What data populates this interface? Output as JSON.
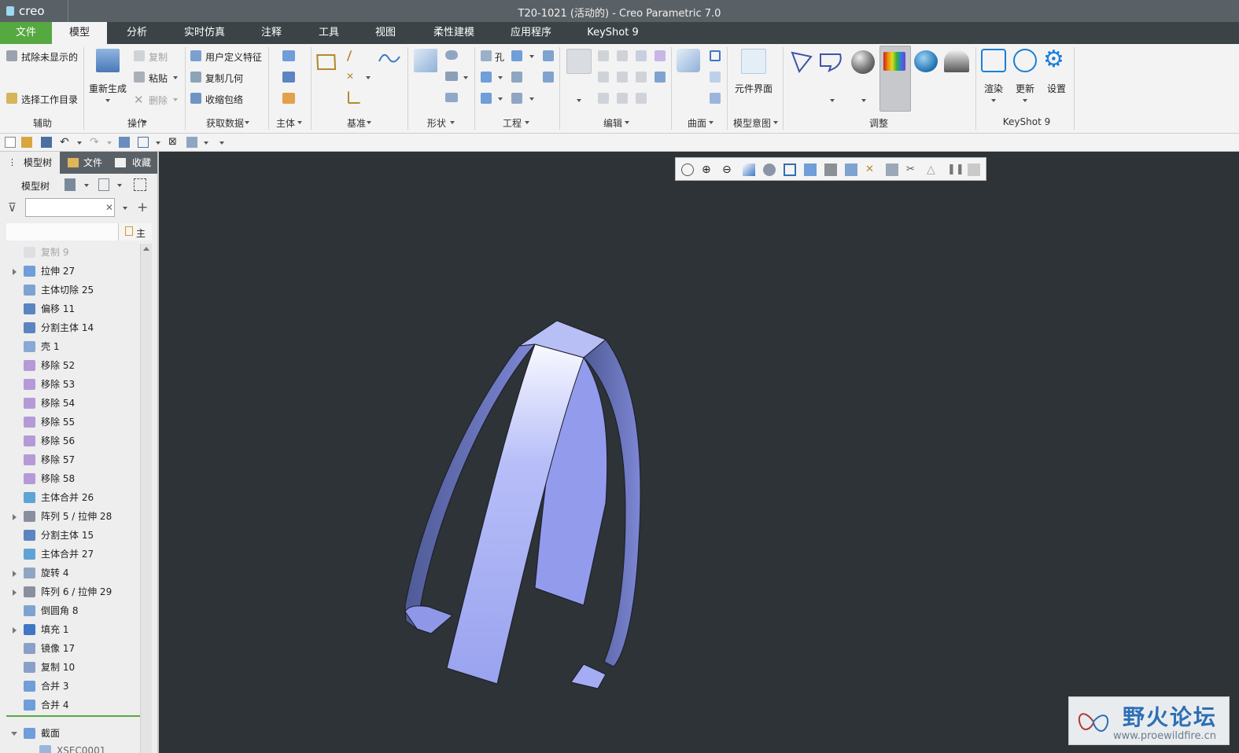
{
  "app": {
    "logo_text": "creo",
    "window_title": "T20-1021 (活动的) - Creo Parametric 7.0"
  },
  "menu_tabs": [
    "文件",
    "模型",
    "分析",
    "实时仿真",
    "注释",
    "工具",
    "视图",
    "柔性建模",
    "应用程序",
    "KeyShot 9"
  ],
  "active_tab": "模型",
  "ribbon": {
    "aux": {
      "hide_unshown": "拭除未显示的",
      "select_workdir": "选择工作目录",
      "label": "辅助"
    },
    "ops": {
      "regen": "重新生成",
      "copy": "复制",
      "paste": "粘贴",
      "delete": "删除",
      "label": "操作"
    },
    "getdata": {
      "udf": "用户定义特征",
      "copy_geom": "复制几何",
      "shrinkwrap": "收缩包络",
      "label": "获取数据"
    },
    "body": {
      "label": "主体"
    },
    "datum": {
      "label": "基准"
    },
    "shape": {
      "label": "形状"
    },
    "eng": {
      "hole": "孔",
      "label": "工程"
    },
    "edit": {
      "label": "编辑"
    },
    "surface": {
      "label": "曲面"
    },
    "intent": {
      "comp_interface": "元件界面",
      "label": "模型意图"
    },
    "adjust": {
      "label": "调整"
    },
    "keyshot": {
      "render": "渲染",
      "update": "更新",
      "settings": "设置",
      "label": "KeyShot 9"
    }
  },
  "left_panel": {
    "tabs": [
      "模型树",
      "文件",
      "收藏"
    ],
    "tree_label": "模型树",
    "filter_placeholder": "",
    "column_header": "主表",
    "items": [
      {
        "label": "复制 9",
        "dimmed": true,
        "expand": ""
      },
      {
        "label": "拉伸 27",
        "expand": "right"
      },
      {
        "label": "主体切除 25",
        "expand": ""
      },
      {
        "label": "偏移 11",
        "expand": ""
      },
      {
        "label": "分割主体 14",
        "expand": ""
      },
      {
        "label": "壳 1",
        "expand": ""
      },
      {
        "label": "移除 52",
        "expand": ""
      },
      {
        "label": "移除 53",
        "expand": ""
      },
      {
        "label": "移除 54",
        "expand": ""
      },
      {
        "label": "移除 55",
        "expand": ""
      },
      {
        "label": "移除 56",
        "expand": ""
      },
      {
        "label": "移除 57",
        "expand": ""
      },
      {
        "label": "移除 58",
        "expand": ""
      },
      {
        "label": "主体合并 26",
        "expand": ""
      },
      {
        "label": "阵列 5 / 拉伸 28",
        "expand": "right"
      },
      {
        "label": "分割主体 15",
        "expand": ""
      },
      {
        "label": "主体合并 27",
        "expand": ""
      },
      {
        "label": "旋转 4",
        "expand": "right"
      },
      {
        "label": "阵列 6 / 拉伸 29",
        "expand": "right"
      },
      {
        "label": "倒圆角 8",
        "expand": ""
      },
      {
        "label": "填充 1",
        "expand": "right"
      },
      {
        "label": "镜像 17",
        "expand": ""
      },
      {
        "label": "复制 10",
        "expand": ""
      },
      {
        "label": "合并 3",
        "expand": ""
      },
      {
        "label": "合并 4",
        "expand": ""
      }
    ],
    "section_node": {
      "label": "截面",
      "child": "XSEC0001"
    }
  },
  "watermark": {
    "title": "野火论坛",
    "url": "www.proewildfire.cn"
  },
  "colors": {
    "file_tab": "#56a840",
    "model_face": "#a3acf5",
    "viewport_bg": "#2d3336"
  }
}
